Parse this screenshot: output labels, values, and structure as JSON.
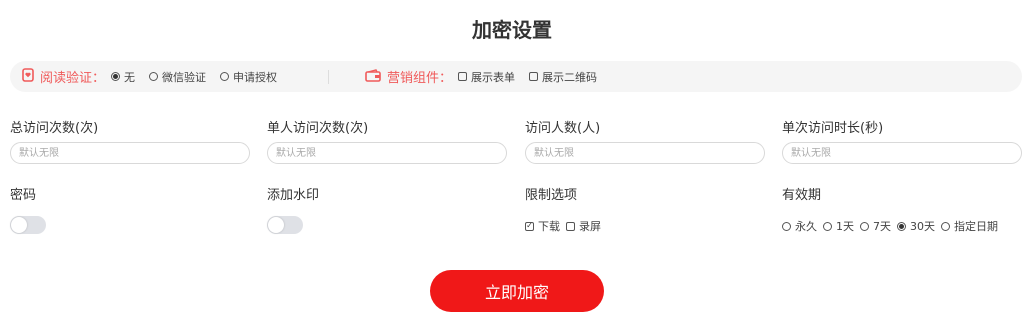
{
  "page": {
    "title": "加密设置"
  },
  "read_verify": {
    "label": "阅读验证：",
    "options": [
      {
        "label": "无",
        "selected": true
      },
      {
        "label": "微信验证",
        "selected": false
      },
      {
        "label": "申请授权",
        "selected": false
      }
    ]
  },
  "marketing": {
    "label": "营销组件：",
    "options": [
      {
        "label": "展示表单",
        "checked": false
      },
      {
        "label": "展示二维码",
        "checked": false
      }
    ]
  },
  "fields": [
    {
      "label": "总访问次数(次)",
      "placeholder": "默认无限"
    },
    {
      "label": "单人访问次数(次)",
      "placeholder": "默认无限"
    },
    {
      "label": "访问人数(人)",
      "placeholder": "默认无限"
    },
    {
      "label": "单次访问时长(秒)",
      "placeholder": "默认无限"
    }
  ],
  "password": {
    "label": "密码",
    "enabled": false
  },
  "watermark": {
    "label": "添加水印",
    "enabled": false
  },
  "limits": {
    "label": "限制选项",
    "options": [
      {
        "label": "下载",
        "checked": true
      },
      {
        "label": "录屏",
        "checked": false
      }
    ]
  },
  "validity": {
    "label": "有效期",
    "options": [
      {
        "label": "永久",
        "selected": false
      },
      {
        "label": "1天",
        "selected": false
      },
      {
        "label": "7天",
        "selected": false
      },
      {
        "label": "30天",
        "selected": true
      },
      {
        "label": "指定日期",
        "selected": false
      }
    ]
  },
  "submit_label": "立即加密",
  "colors": {
    "accent": "#f01818",
    "label_red": "#f05a5a",
    "toggle_off": "#dfe1e6"
  },
  "icons": {
    "read_verify": "phone-heart-icon",
    "marketing": "wallet-icon"
  }
}
